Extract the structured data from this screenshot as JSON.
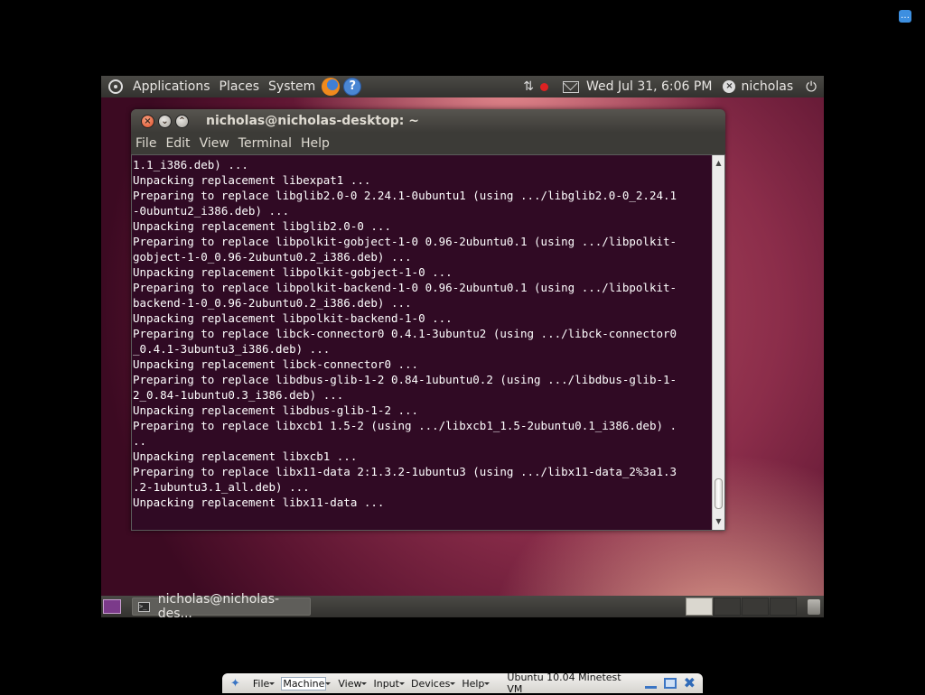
{
  "host": {
    "notification_icon": "speech-bubble-icon"
  },
  "top_panel": {
    "menus": [
      "Applications",
      "Places",
      "System"
    ],
    "clock": "Wed Jul 31,  6:06 PM",
    "username": "nicholas"
  },
  "terminal": {
    "title": "nicholas@nicholas-desktop: ~",
    "menu": [
      "File",
      "Edit",
      "View",
      "Terminal",
      "Help"
    ],
    "lines": [
      "1.1_i386.deb) ...",
      "Unpacking replacement libexpat1 ...",
      "Preparing to replace libglib2.0-0 2.24.1-0ubuntu1 (using .../libglib2.0-0_2.24.1",
      "-0ubuntu2_i386.deb) ...",
      "Unpacking replacement libglib2.0-0 ...",
      "Preparing to replace libpolkit-gobject-1-0 0.96-2ubuntu0.1 (using .../libpolkit-",
      "gobject-1-0_0.96-2ubuntu0.2_i386.deb) ...",
      "Unpacking replacement libpolkit-gobject-1-0 ...",
      "Preparing to replace libpolkit-backend-1-0 0.96-2ubuntu0.1 (using .../libpolkit-",
      "backend-1-0_0.96-2ubuntu0.2_i386.deb) ...",
      "Unpacking replacement libpolkit-backend-1-0 ...",
      "Preparing to replace libck-connector0 0.4.1-3ubuntu2 (using .../libck-connector0",
      "_0.4.1-3ubuntu3_i386.deb) ...",
      "Unpacking replacement libck-connector0 ...",
      "Preparing to replace libdbus-glib-1-2 0.84-1ubuntu0.2 (using .../libdbus-glib-1-",
      "2_0.84-1ubuntu0.3_i386.deb) ...",
      "Unpacking replacement libdbus-glib-1-2 ...",
      "Preparing to replace libxcb1 1.5-2 (using .../libxcb1_1.5-2ubuntu0.1_i386.deb) .",
      "..",
      "Unpacking replacement libxcb1 ...",
      "Preparing to replace libx11-data 2:1.3.2-1ubuntu3 (using .../libx11-data_2%3a1.3",
      ".2-1ubuntu3.1_all.deb) ...",
      "Unpacking replacement libx11-data ..."
    ]
  },
  "bottom_panel": {
    "task_label": "nicholas@nicholas-des..."
  },
  "vbox_bar": {
    "menus": [
      "File",
      "Machine",
      "View",
      "Input",
      "Devices",
      "Help"
    ],
    "vm_name": "Ubuntu 10.04 Minetest VM"
  }
}
